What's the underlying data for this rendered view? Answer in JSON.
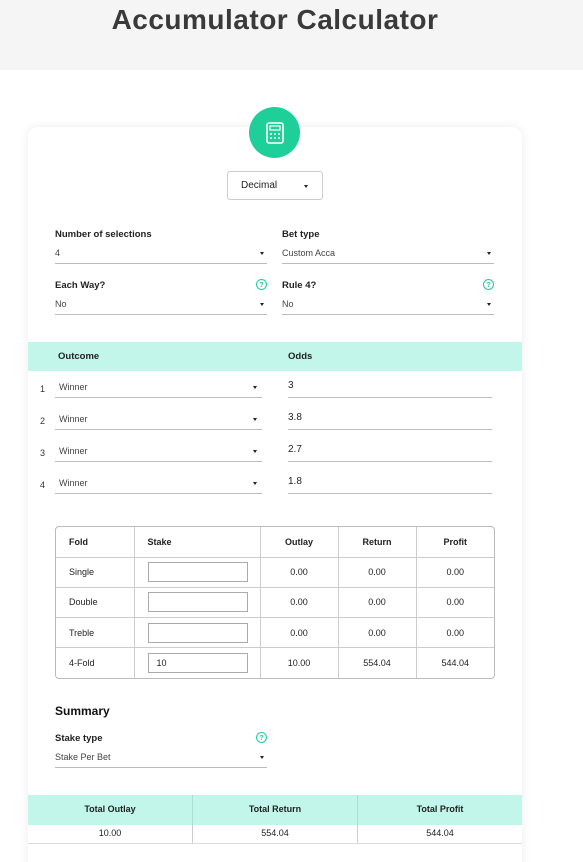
{
  "page": {
    "title": "Accumulator Calculator"
  },
  "odds_format": {
    "value": "Decimal"
  },
  "settings": {
    "selections_label": "Number of selections",
    "selections_value": "4",
    "bet_type_label": "Bet type",
    "bet_type_value": "Custom Acca",
    "each_way_label": "Each Way?",
    "each_way_value": "No",
    "rule4_label": "Rule 4?",
    "rule4_value": "No",
    "help_glyph": "?"
  },
  "outcomes": {
    "outcome_header": "Outcome",
    "odds_header": "Odds",
    "rows": [
      {
        "num": "1",
        "outcome": "Winner",
        "odds": "3"
      },
      {
        "num": "2",
        "outcome": "Winner",
        "odds": "3.8"
      },
      {
        "num": "3",
        "outcome": "Winner",
        "odds": "2.7"
      },
      {
        "num": "4",
        "outcome": "Winner",
        "odds": "1.8"
      }
    ]
  },
  "fold_table": {
    "headers": [
      "Fold",
      "Stake",
      "Outlay",
      "Return",
      "Profit"
    ],
    "rows": [
      {
        "fold": "Single",
        "stake": "",
        "outlay": "0.00",
        "return": "0.00",
        "profit": "0.00"
      },
      {
        "fold": "Double",
        "stake": "",
        "outlay": "0.00",
        "return": "0.00",
        "profit": "0.00"
      },
      {
        "fold": "Treble",
        "stake": "",
        "outlay": "0.00",
        "return": "0.00",
        "profit": "0.00"
      },
      {
        "fold": "4-Fold",
        "stake": "10",
        "outlay": "10.00",
        "return": "554.04",
        "profit": "544.04"
      }
    ]
  },
  "summary": {
    "title": "Summary",
    "stake_type_label": "Stake type",
    "stake_type_value": "Stake Per Bet"
  },
  "totals": {
    "outlay_label": "Total Outlay",
    "return_label": "Total Return",
    "profit_label": "Total Profit",
    "outlay_value": "10.00",
    "return_value": "554.04",
    "profit_value": "544.04"
  },
  "colors": {
    "accent": "#1fcf9a",
    "header_band": "#c2f6eb",
    "page_bg": "#f5f5f5"
  },
  "icons": {
    "calculator": "calculator-icon",
    "dropdown": "caret-down-icon",
    "help": "help-icon"
  }
}
